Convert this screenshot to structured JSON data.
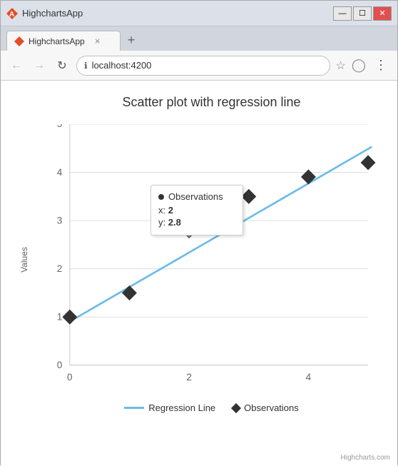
{
  "browser": {
    "title": "HighchartsApp",
    "url": "localhost:4200",
    "tab_close": "×",
    "new_tab": "+",
    "favicon_color": "#e44d26"
  },
  "chart": {
    "title": "Scatter plot with regression line",
    "y_axis_label": "Values",
    "x_axis_ticks": [
      "0",
      "2",
      "4"
    ],
    "y_axis_ticks": [
      "0",
      "1",
      "2",
      "3",
      "4",
      "5"
    ],
    "tooltip": {
      "series": "Observations",
      "x_label": "x:",
      "x_value": "2",
      "y_label": "y:",
      "y_value": "2.8"
    },
    "legend": {
      "regression_label": "Regression Line",
      "observations_label": "Observations"
    },
    "credit": "Highcharts.com",
    "scatter_points": [
      {
        "x": 0,
        "y": 1
      },
      {
        "x": 1,
        "y": 1.5
      },
      {
        "x": 2,
        "y": 2.8
      },
      {
        "x": 3,
        "y": 3.5
      },
      {
        "x": 4,
        "y": 3.9
      },
      {
        "x": 5,
        "y": 4.2
      }
    ],
    "regression_line": {
      "x1": -0.2,
      "y1": 0.8,
      "x2": 5.5,
      "y2": 4.5
    }
  }
}
